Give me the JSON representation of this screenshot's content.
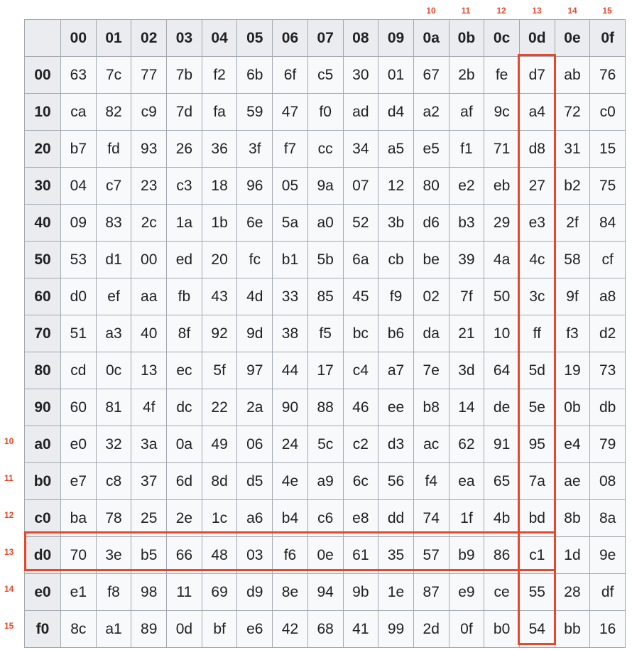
{
  "column_annotations": [
    "10",
    "11",
    "12",
    "13",
    "14",
    "15"
  ],
  "row_annotations": [
    "10",
    "11",
    "12",
    "13",
    "14",
    "15"
  ],
  "column_headers": [
    "00",
    "01",
    "02",
    "03",
    "04",
    "05",
    "06",
    "07",
    "08",
    "09",
    "0a",
    "0b",
    "0c",
    "0d",
    "0e",
    "0f"
  ],
  "rows": [
    {
      "header": "00",
      "cells": [
        "63",
        "7c",
        "77",
        "7b",
        "f2",
        "6b",
        "6f",
        "c5",
        "30",
        "01",
        "67",
        "2b",
        "fe",
        "d7",
        "ab",
        "76"
      ]
    },
    {
      "header": "10",
      "cells": [
        "ca",
        "82",
        "c9",
        "7d",
        "fa",
        "59",
        "47",
        "f0",
        "ad",
        "d4",
        "a2",
        "af",
        "9c",
        "a4",
        "72",
        "c0"
      ]
    },
    {
      "header": "20",
      "cells": [
        "b7",
        "fd",
        "93",
        "26",
        "36",
        "3f",
        "f7",
        "cc",
        "34",
        "a5",
        "e5",
        "f1",
        "71",
        "d8",
        "31",
        "15"
      ]
    },
    {
      "header": "30",
      "cells": [
        "04",
        "c7",
        "23",
        "c3",
        "18",
        "96",
        "05",
        "9a",
        "07",
        "12",
        "80",
        "e2",
        "eb",
        "27",
        "b2",
        "75"
      ]
    },
    {
      "header": "40",
      "cells": [
        "09",
        "83",
        "2c",
        "1a",
        "1b",
        "6e",
        "5a",
        "a0",
        "52",
        "3b",
        "d6",
        "b3",
        "29",
        "e3",
        "2f",
        "84"
      ]
    },
    {
      "header": "50",
      "cells": [
        "53",
        "d1",
        "00",
        "ed",
        "20",
        "fc",
        "b1",
        "5b",
        "6a",
        "cb",
        "be",
        "39",
        "4a",
        "4c",
        "58",
        "cf"
      ]
    },
    {
      "header": "60",
      "cells": [
        "d0",
        "ef",
        "aa",
        "fb",
        "43",
        "4d",
        "33",
        "85",
        "45",
        "f9",
        "02",
        "7f",
        "50",
        "3c",
        "9f",
        "a8"
      ]
    },
    {
      "header": "70",
      "cells": [
        "51",
        "a3",
        "40",
        "8f",
        "92",
        "9d",
        "38",
        "f5",
        "bc",
        "b6",
        "da",
        "21",
        "10",
        "ff",
        "f3",
        "d2"
      ]
    },
    {
      "header": "80",
      "cells": [
        "cd",
        "0c",
        "13",
        "ec",
        "5f",
        "97",
        "44",
        "17",
        "c4",
        "a7",
        "7e",
        "3d",
        "64",
        "5d",
        "19",
        "73"
      ]
    },
    {
      "header": "90",
      "cells": [
        "60",
        "81",
        "4f",
        "dc",
        "22",
        "2a",
        "90",
        "88",
        "46",
        "ee",
        "b8",
        "14",
        "de",
        "5e",
        "0b",
        "db"
      ]
    },
    {
      "header": "a0",
      "cells": [
        "e0",
        "32",
        "3a",
        "0a",
        "49",
        "06",
        "24",
        "5c",
        "c2",
        "d3",
        "ac",
        "62",
        "91",
        "95",
        "e4",
        "79"
      ]
    },
    {
      "header": "b0",
      "cells": [
        "e7",
        "c8",
        "37",
        "6d",
        "8d",
        "d5",
        "4e",
        "a9",
        "6c",
        "56",
        "f4",
        "ea",
        "65",
        "7a",
        "ae",
        "08"
      ]
    },
    {
      "header": "c0",
      "cells": [
        "ba",
        "78",
        "25",
        "2e",
        "1c",
        "a6",
        "b4",
        "c6",
        "e8",
        "dd",
        "74",
        "1f",
        "4b",
        "bd",
        "8b",
        "8a"
      ]
    },
    {
      "header": "d0",
      "cells": [
        "70",
        "3e",
        "b5",
        "66",
        "48",
        "03",
        "f6",
        "0e",
        "61",
        "35",
        "57",
        "b9",
        "86",
        "c1",
        "1d",
        "9e"
      ]
    },
    {
      "header": "e0",
      "cells": [
        "e1",
        "f8",
        "98",
        "11",
        "69",
        "d9",
        "8e",
        "94",
        "9b",
        "1e",
        "87",
        "e9",
        "ce",
        "55",
        "28",
        "df"
      ]
    },
    {
      "header": "f0",
      "cells": [
        "8c",
        "a1",
        "89",
        "0d",
        "bf",
        "e6",
        "42",
        "68",
        "41",
        "99",
        "2d",
        "0f",
        "b0",
        "54",
        "bb",
        "16"
      ]
    }
  ],
  "highlight": {
    "row": "d0",
    "column": "0d",
    "color": "#e8472b"
  },
  "colors": {
    "header_bg": "#eaecf0",
    "cell_bg": "#f8f9fa",
    "border": "#a2a9b1",
    "annotation": "#e8472b"
  }
}
